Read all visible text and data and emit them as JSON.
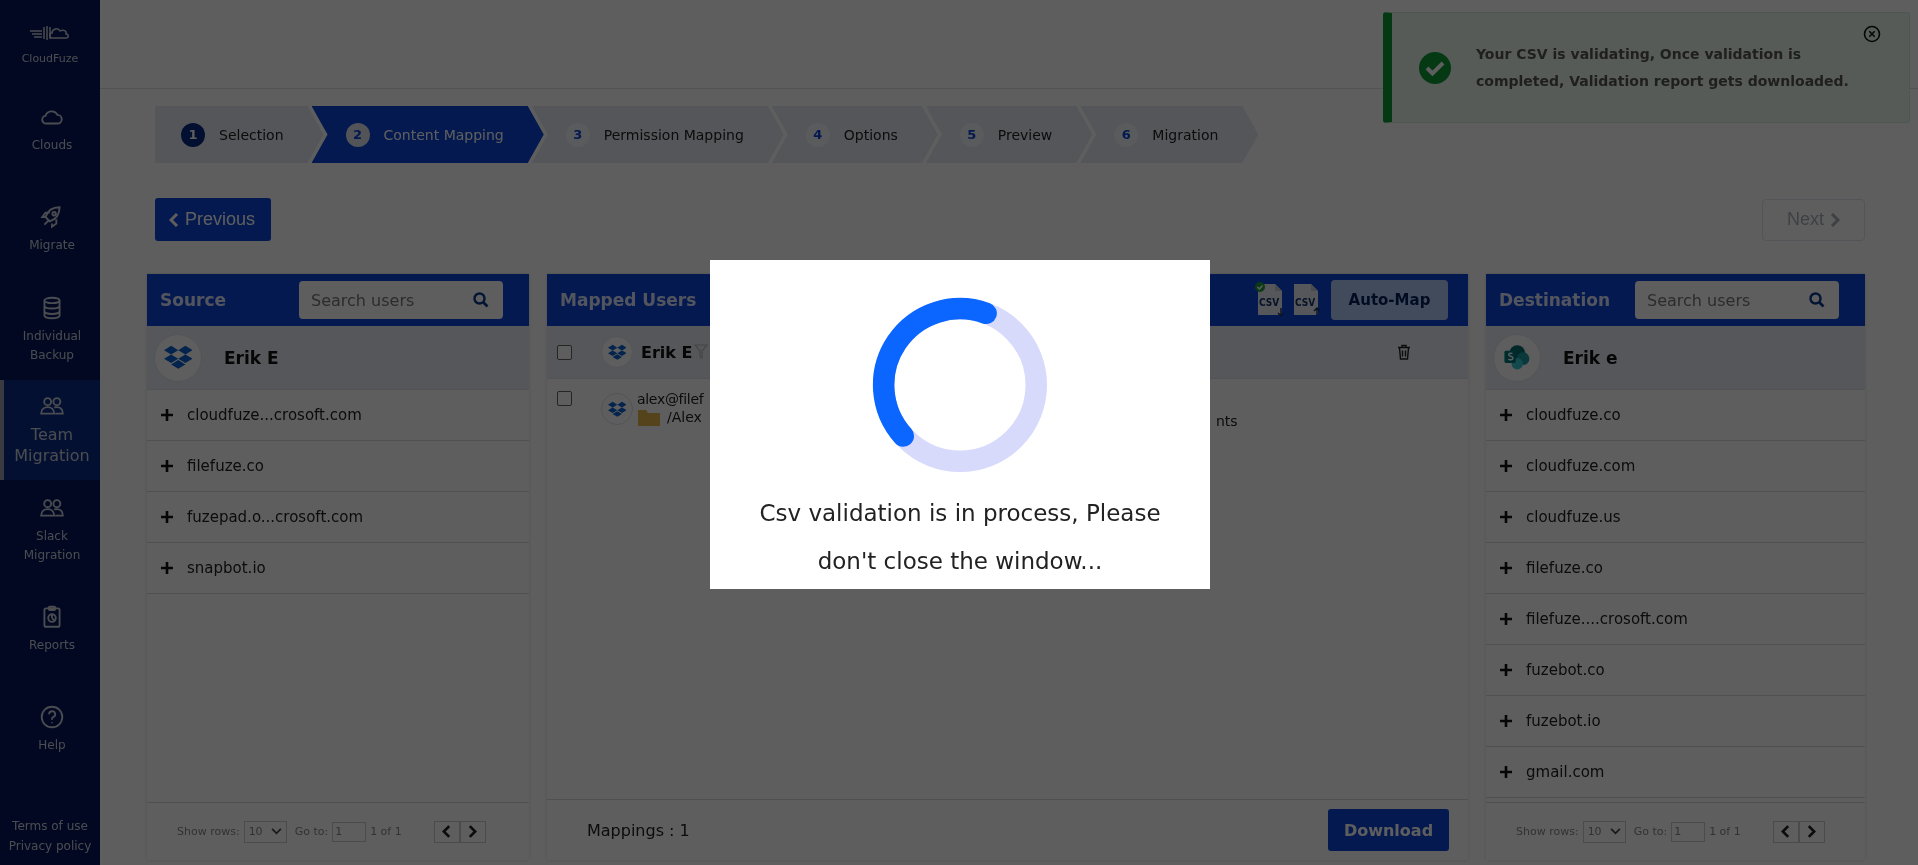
{
  "sidebar": {
    "brand": "CloudFuze",
    "items": [
      {
        "label": "Clouds",
        "selected": false
      },
      {
        "label": "Migrate",
        "selected": false
      },
      {
        "label": "Individual Backup",
        "selected": false
      },
      {
        "label": "Team Migration",
        "selected": true
      },
      {
        "label": "Slack Migration",
        "selected": false
      },
      {
        "label": "Reports",
        "selected": false
      },
      {
        "label": "Help",
        "selected": false
      }
    ],
    "links": [
      "Terms of use",
      "Privacy policy"
    ]
  },
  "toast": {
    "kind": "success",
    "message": "Your CSV is validating, Once validation is completed, Validation report gets downloaded."
  },
  "stepper": [
    {
      "number": "1",
      "label": "Selection",
      "completed": true,
      "selected": false
    },
    {
      "number": "2",
      "label": "Content Mapping",
      "completed": false,
      "selected": true
    },
    {
      "number": "3",
      "label": "Permission Mapping",
      "completed": false,
      "selected": false
    },
    {
      "number": "4",
      "label": "Options",
      "completed": false,
      "selected": false
    },
    {
      "number": "5",
      "label": "Preview",
      "completed": false,
      "selected": false
    },
    {
      "number": "6",
      "label": "Migration",
      "completed": false,
      "selected": false
    }
  ],
  "previous_button": "Previous",
  "next_button": {
    "label": "Next",
    "disabled": true
  },
  "source": {
    "title": "Source",
    "search_placeholder": "Search users",
    "user": "Erik E",
    "items": [
      "cloudfuze...crosoft.com",
      "filefuze.co",
      "fuzepad.o...crosoft.com",
      "snapbot.io"
    ],
    "footer": {
      "show_rows_label": "Show rows:",
      "rows_value": "10",
      "goto_label": "Go to:",
      "goto_value": "1",
      "page_info": "1 of 1"
    }
  },
  "mapped": {
    "title": "Mapped Users",
    "csv_icons": [
      {
        "label": "CSV",
        "validated": true
      },
      {
        "label": "CSV",
        "validated": false
      }
    ],
    "automap": {
      "label": "Auto-Map",
      "disabled": true
    },
    "header": {
      "name": "Erik E",
      "checked": false
    },
    "rows": [
      {
        "checked": false,
        "email": "alex@filef",
        "path": "/Alex",
        "path_end": "nts"
      }
    ],
    "mappings": "Mappings : 1",
    "download": "Download"
  },
  "destination": {
    "title": "Destination",
    "search_placeholder": "Search users",
    "user": "Erik e",
    "items": [
      "cloudfuze.co",
      "cloudfuze.com",
      "cloudfuze.us",
      "filefuze.co",
      "filefuze....crosoft.com",
      "fuzebot.co",
      "fuzebot.io",
      "gmail.com"
    ],
    "footer": {
      "show_rows_label": "Show rows:",
      "rows_value": "10",
      "goto_label": "Go to:",
      "goto_value": "1",
      "page_info": "1 of 1"
    }
  },
  "modal": {
    "message": "Csv validation is in process, Please don't close the window..."
  }
}
